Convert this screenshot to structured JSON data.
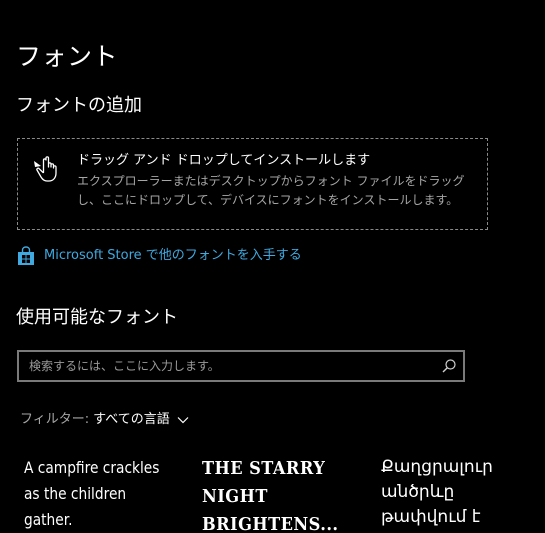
{
  "page": {
    "title": "フォント"
  },
  "add_section": {
    "title": "フォントの追加",
    "drop_zone": {
      "title": "ドラッグ アンド ドロップしてインストールします",
      "description": "エクスプローラーまたはデスクトップからフォント ファイルをドラッグし、ここにドロップして、デバイスにフォントをインストールします。",
      "icon": "hand-pointer-icon"
    },
    "store_link": {
      "label": "Microsoft Store で他のフォントを入手する",
      "icon": "store-bag-icon"
    }
  },
  "available_section": {
    "title": "使用可能なフォント",
    "search": {
      "value": "",
      "placeholder": "検索するには、ここに入力します。",
      "icon": "search-icon"
    },
    "filter": {
      "label": "フィルター:",
      "value": "すべての言語",
      "icon": "chevron-down-icon"
    },
    "font_cards": [
      {
        "sample": "A campfire crackles as the children gather."
      },
      {
        "sample": "THE STARRY NIGHT",
        "sample_line2": "BRIGHTENS..."
      },
      {
        "sample": "Քաղցրալուր անծրևը թափվում է"
      }
    ]
  },
  "colors": {
    "background": "#000000",
    "text": "#ffffff",
    "secondary_text": "#a6a6a6",
    "accent_link": "#3fa9e0",
    "border": "#8a8a8a"
  }
}
